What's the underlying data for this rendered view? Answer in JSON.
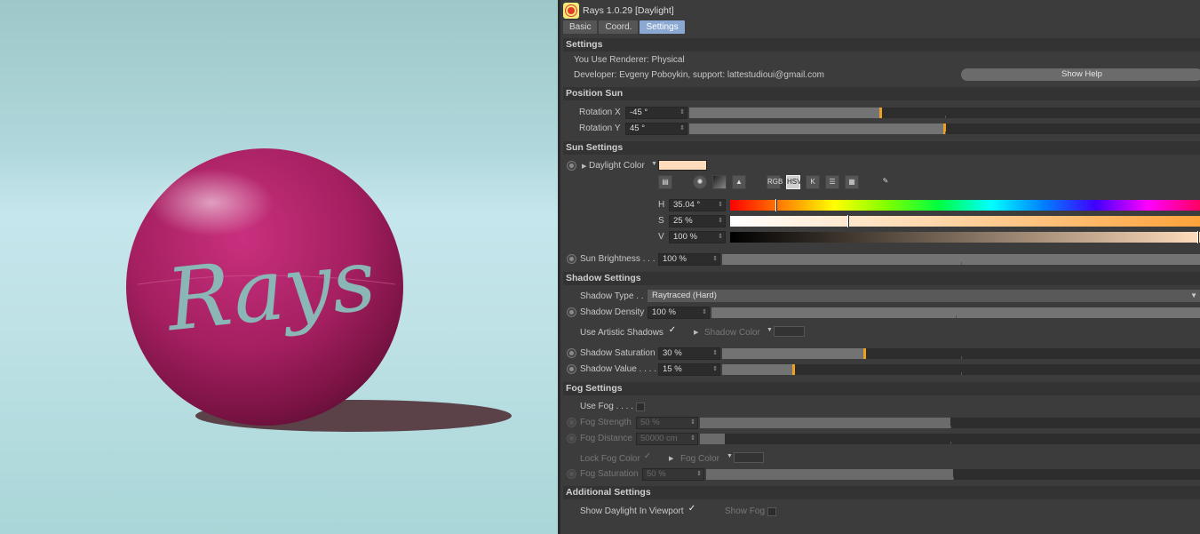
{
  "viewport": {
    "ball_logo_text": "Rays",
    "colors": {
      "ball": "#b0236b",
      "logo": "#8ab6b6",
      "shadow": "#5a4248",
      "background": "#bfe2e6"
    }
  },
  "window": {
    "title": "Rays 1.0.29 [Daylight]",
    "icon": "sun-icon"
  },
  "tabs": [
    {
      "label": "Basic",
      "active": false
    },
    {
      "label": "Coord.",
      "active": false
    },
    {
      "label": "Settings",
      "active": true
    }
  ],
  "settings": {
    "header": "Settings",
    "renderer_text": "You Use Renderer: Physical",
    "developer_text": "Developer: Evgeny Poboykin, support: lattestudioui@gmail.com",
    "show_help_label": "Show Help"
  },
  "position_sun": {
    "header": "Position Sun",
    "rotation_x": {
      "label": "Rotation X",
      "value": "-45 °",
      "level": 0.375
    },
    "rotation_y": {
      "label": "Rotation Y",
      "value": "45 °",
      "level": 0.5
    }
  },
  "sun_settings": {
    "header": "Sun Settings",
    "daylight_color_label": "Daylight Color",
    "daylight_color": "#ffdcbb",
    "picker_modes": [
      "spectrum-icon",
      "wheel-icon",
      "gradient-icon",
      "image-icon",
      "RGB",
      "HSV",
      "K",
      "mixer-icon",
      "swatches-icon",
      "eyedropper-icon"
    ],
    "h": {
      "label": "H",
      "value": "35.04 °",
      "level": 0.097
    },
    "s": {
      "label": "S",
      "value": "25 %",
      "level": 0.25
    },
    "v": {
      "label": "V",
      "value": "100 %",
      "level": 1.0
    },
    "sun_brightness": {
      "label": "Sun Brightness . . .",
      "value": "100 %",
      "level": 1.0
    }
  },
  "shadow_settings": {
    "header": "Shadow Settings",
    "shadow_type_label": "Shadow Type . .",
    "shadow_type_value": "Raytraced (Hard)",
    "shadow_density": {
      "label": "Shadow Density",
      "value": "100 %",
      "level": 1.0
    },
    "use_artistic_label": "Use Artistic Shadows",
    "use_artistic_checked": "✓",
    "shadow_color_label": "Shadow Color",
    "shadow_saturation": {
      "label": "Shadow Saturation",
      "value": "30 %",
      "level": 0.3
    },
    "shadow_value": {
      "label": "Shadow Value . . . .",
      "value": "15 %",
      "level": 0.15
    }
  },
  "fog_settings": {
    "header": "Fog Settings",
    "use_fog_label": "Use Fog . . . .",
    "fog_strength": {
      "label": "Fog Strength",
      "value": "50 %",
      "level": 0.5
    },
    "fog_distance": {
      "label": "Fog Distance",
      "value": "50000 cm",
      "level": 0.05
    },
    "lock_fog_color_label": "Lock Fog Color",
    "lock_fog_checked": "✓",
    "fog_color_label": "Fog Color",
    "fog_saturation": {
      "label": "Fog Saturation",
      "value": "50 %",
      "level": 0.5
    }
  },
  "additional_settings": {
    "header": "Additional Settings",
    "show_daylight_label": "Show Daylight In Viewport",
    "show_daylight_checked": "✓",
    "show_fog_label": "Show Fog"
  }
}
